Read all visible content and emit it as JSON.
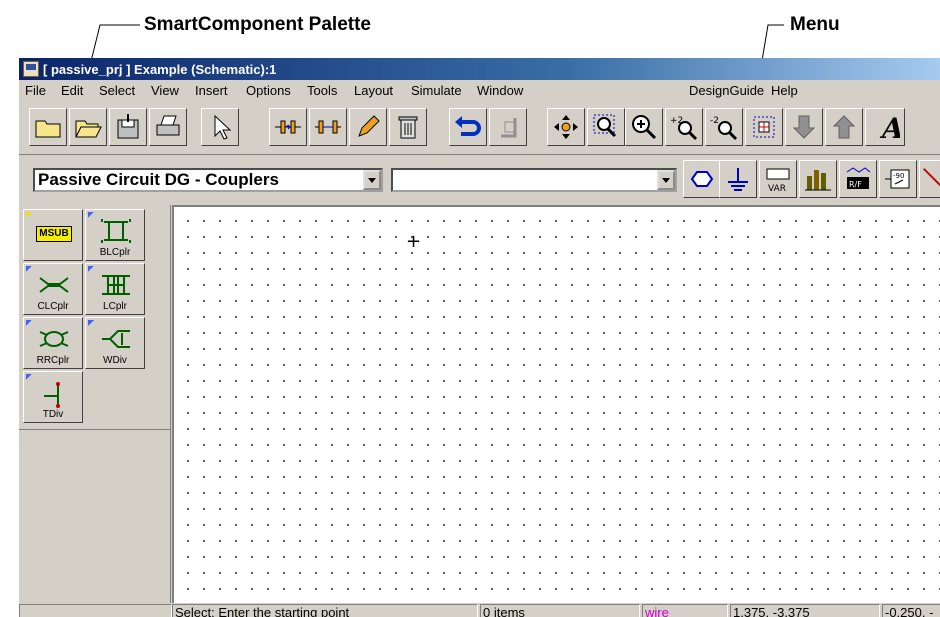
{
  "callouts": {
    "palette_label": "SmartComponent Palette",
    "menu_label": "Menu"
  },
  "window": {
    "title": "[ passive_prj ] Example (Schematic):1"
  },
  "menu": {
    "items": [
      "File",
      "Edit",
      "Select",
      "View",
      "Insert",
      "Options",
      "Tools",
      "Layout",
      "Simulate",
      "Window",
      "DesignGuide",
      "Help"
    ]
  },
  "toolbar2": {
    "palette_select": "Passive Circuit DG - Couplers",
    "component_select": "",
    "var_label": "VAR"
  },
  "palette": {
    "items": [
      {
        "label": "MSUB"
      },
      {
        "label": "BLCplr"
      },
      {
        "label": "CLCplr"
      },
      {
        "label": "LCplr"
      },
      {
        "label": "RRCplr"
      },
      {
        "label": "WDiv"
      },
      {
        "label": "TDiv"
      }
    ]
  },
  "statusbar": {
    "prompt": "Select: Enter the starting point",
    "items": "0 items",
    "mode": "wire",
    "coords": "1.375, -3.375",
    "coords2": "-0.250, -"
  },
  "colors": {
    "mode_text": "#cc00cc",
    "titlebar": "#0a246a"
  }
}
